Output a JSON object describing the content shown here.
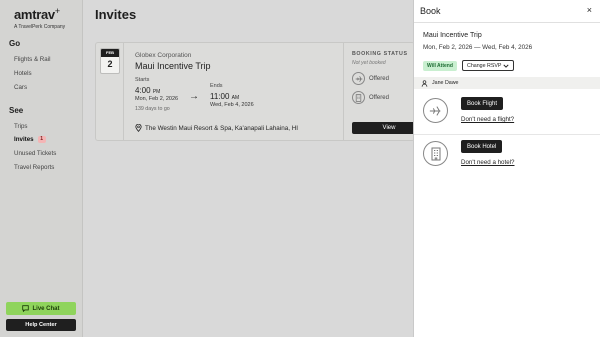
{
  "brand": {
    "name": "amtrav",
    "subtitle": "A TravelPerk Company"
  },
  "sidebar": {
    "go_heading": "Go",
    "go_items": [
      {
        "label": "Flights & Rail"
      },
      {
        "label": "Hotels"
      },
      {
        "label": "Cars"
      }
    ],
    "see_heading": "See",
    "see_items": [
      {
        "label": "Trips"
      },
      {
        "label": "Invites",
        "badge": "1",
        "active": true
      },
      {
        "label": "Unused Tickets"
      },
      {
        "label": "Travel Reports"
      }
    ],
    "live_chat_label": "Live Chat",
    "help_center_label": "Help Center"
  },
  "main": {
    "title": "Invites",
    "card": {
      "month": "FEB",
      "day": "2",
      "company": "Globex Corporation",
      "trip_name": "Maui Incentive Trip",
      "starts_label": "Starts",
      "start_time": "4:00",
      "start_ampm": "PM",
      "start_date": "Mon, Feb 2, 2026",
      "days_to_go": "139 days to go",
      "ends_label": "Ends",
      "end_time": "11:00",
      "end_ampm": "AM",
      "end_date": "Wed, Feb 4, 2026",
      "address": "The Westin Maui Resort & Spa, Ka'anapali Lahaina, HI",
      "booking_status_title": "BOOKING STATUS",
      "booking_status_sub": "Not yet booked",
      "offer_flight": "Offered",
      "offer_hotel": "Offered",
      "view_label": "View"
    }
  },
  "panel": {
    "title": "Book",
    "close_label": "×",
    "trip_name": "Maui Incentive Trip",
    "dates": "Mon, Feb 2, 2026 — Wed, Feb 4, 2026",
    "attend_badge": "Will Attend",
    "change_rsvp_label": "Change RSVP",
    "guest_name": "Jane Dawe",
    "book_flight_label": "Book Flight",
    "no_flight_label": "Don't need a flight?",
    "book_hotel_label": "Book Hotel",
    "no_hotel_label": "Don't need a hotel?"
  },
  "colors": {
    "live_chat": "#8fd45c",
    "attend_badge_bg": "#c9efd0",
    "badge_bg": "#f4b5b5",
    "dark": "#1f1f1f"
  },
  "icons": [
    "chat-icon",
    "pin-icon",
    "plane-icon",
    "hotel-icon",
    "person-icon",
    "chevron-down-icon",
    "arrow-right-icon",
    "close-icon"
  ]
}
